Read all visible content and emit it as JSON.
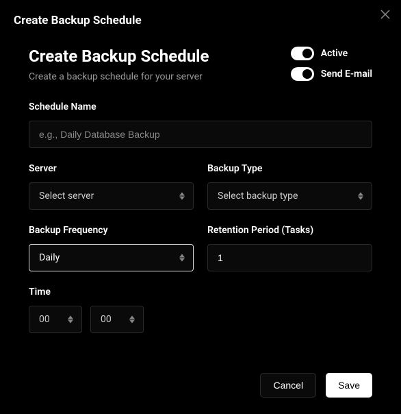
{
  "dialog_title": "Create Backup Schedule",
  "header": {
    "title": "Create Backup Schedule",
    "subtitle": "Create a backup schedule for your server"
  },
  "toggles": {
    "active_label": "Active",
    "email_label": "Send E-mail"
  },
  "fields": {
    "schedule_name": {
      "label": "Schedule Name",
      "placeholder": "e.g., Daily Database Backup",
      "value": ""
    },
    "server": {
      "label": "Server",
      "value": "Select server"
    },
    "backup_type": {
      "label": "Backup Type",
      "value": "Select backup type"
    },
    "frequency": {
      "label": "Backup Frequency",
      "value": "Daily"
    },
    "retention": {
      "label": "Retention Period (Tasks)",
      "value": "1"
    },
    "time": {
      "label": "Time",
      "hour": "00",
      "minute": "00"
    }
  },
  "footer": {
    "cancel": "Cancel",
    "save": "Save"
  }
}
